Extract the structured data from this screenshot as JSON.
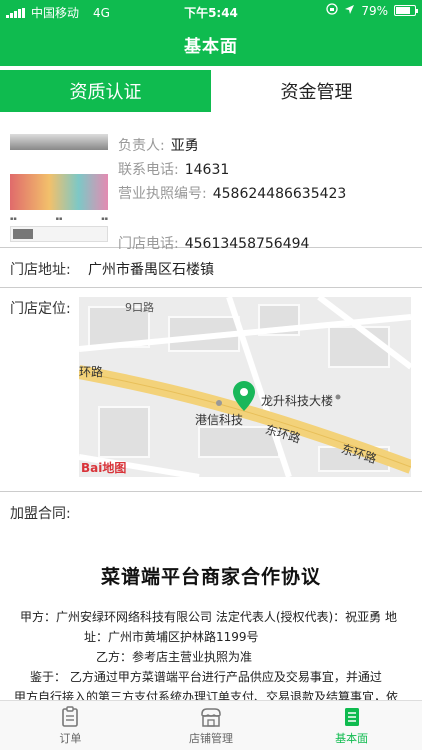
{
  "status_bar": {
    "carrier": "中国移动",
    "network": "4G",
    "time": "下午5:44",
    "battery_percent": "79%",
    "battery_level": 0.79
  },
  "nav": {
    "title": "基本面"
  },
  "tabs": [
    {
      "label": "资质认证",
      "active": true
    },
    {
      "label": "资金管理",
      "active": false
    }
  ],
  "store": {
    "owner_label": "负责人:",
    "owner": "亚勇",
    "phone_label": "联系电话:",
    "phone": "14631",
    "license_label": "营业执照编号:",
    "license": "458624486635423",
    "store_phone_label": "门店电话:",
    "store_phone": "45613458756494",
    "address_label": "门店地址:",
    "address": "广州市番禺区石楼镇",
    "location_label": "门店定位:"
  },
  "map": {
    "poi_main": "龙升科技大楼",
    "poi_secondary": "港信科技",
    "road_west": "环路",
    "road_east_1": "东环路",
    "road_east_2": "东环路",
    "road_top": "9口路",
    "logo": "Bai地图"
  },
  "contract": {
    "label": "加盟合同:",
    "title": "菜谱端平台商家合作协议",
    "line1": "甲方：广州安绿环网络科技有限公司   法定代表人(授权代表)：祝亚勇   地",
    "line2": "址：广州市黄埔区护林路1199号",
    "line3": "乙方：参考店主营业执照为准",
    "line4": "鉴于：  乙方通过甲方菜谱端平台进行产品供应及交易事宜，并通过",
    "line5": "甲方自行接入的第三方支付系统办理订单支付、交易退款及结算事宜，依"
  },
  "tabbar": [
    {
      "label": "订单",
      "icon": "order-icon",
      "active": false
    },
    {
      "label": "店铺管理",
      "icon": "store-icon",
      "active": false
    },
    {
      "label": "基本面",
      "icon": "basic-icon",
      "active": true
    }
  ],
  "colors": {
    "brand": "#0fbb4f",
    "map_bg": "#ececec",
    "road": "#f3d27a"
  }
}
